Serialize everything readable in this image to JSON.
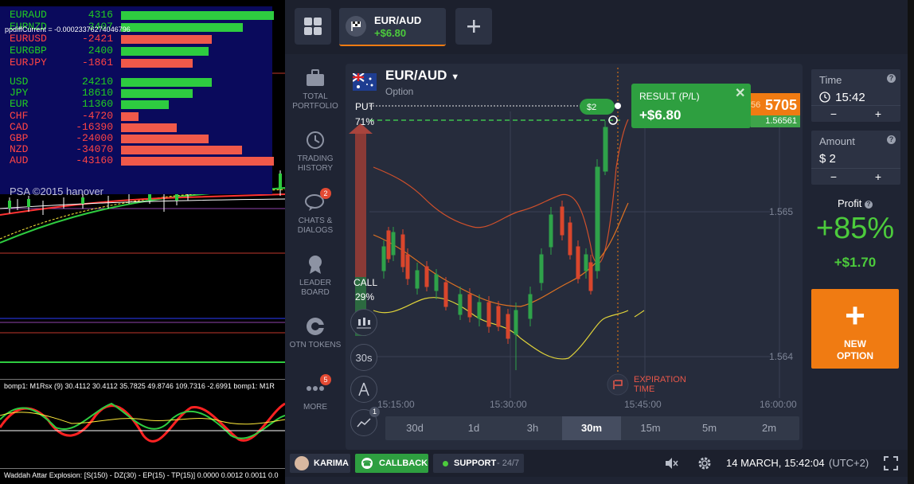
{
  "mt4": {
    "debug_text": "ppdiffCurrent = -0.00023376274046796",
    "pairs": [
      {
        "name": "EURAUD",
        "value": "4316",
        "color": "#22cc22"
      },
      {
        "name": "EURNZD",
        "value": "3407",
        "color": "#22cc22"
      },
      {
        "name": "EURUSD",
        "value": "-2421",
        "color": "#ff4444"
      },
      {
        "name": "EURGBP",
        "value": "2400",
        "color": "#22cc22"
      },
      {
        "name": "EURJPY",
        "value": "-1861",
        "color": "#ff4444"
      }
    ],
    "currencies": [
      {
        "name": "USD",
        "value": "24210",
        "color": "#22cc22"
      },
      {
        "name": "JPY",
        "value": "18610",
        "color": "#22cc22"
      },
      {
        "name": "EUR",
        "value": "11360",
        "color": "#22cc22"
      },
      {
        "name": "CHF",
        "value": "-4720",
        "color": "#ff4444"
      },
      {
        "name": "CAD",
        "value": "-16390",
        "color": "#ff4444"
      },
      {
        "name": "GBP",
        "value": "-24000",
        "color": "#ff4444"
      },
      {
        "name": "NZD",
        "value": "-34070",
        "color": "#ff4444"
      },
      {
        "name": "AUD",
        "value": "-43160",
        "color": "#ff4444"
      }
    ],
    "watermark": "PSA ©2015 hanover",
    "indicator1_label": "bomp1: M1Rsx (9) 30.4112 30.4112 35.7825 49.8746 109.7316 -2.6991 bomp1: M1R",
    "indicator2_label": "Waddah Attar Explosion: [S(150) - DZ(30) - EP(15) - TP(15)] 0.0000 0.0012 0.0011 0.0"
  },
  "topbar": {
    "asset_name": "EUR/AUD",
    "asset_profit": "+$6.80"
  },
  "sidebar": {
    "items": [
      {
        "label": "TOTAL PORTFOLIO",
        "icon": "briefcase-icon"
      },
      {
        "label": "TRADING HISTORY",
        "icon": "history-icon"
      },
      {
        "label": "CHATS & DIALOGS",
        "icon": "chat-icon",
        "badge": "2"
      },
      {
        "label": "LEADER BOARD",
        "icon": "medal-icon"
      },
      {
        "label": "OTN TOKENS",
        "icon": "token-icon"
      },
      {
        "label": "MORE",
        "icon": "more-icon",
        "badge": "5"
      }
    ]
  },
  "chart": {
    "pair": "EUR/AUD",
    "subtitle": "Option",
    "put_label": "PUT",
    "put_pct": "71%",
    "call_label": "CALL",
    "call_pct": "29%",
    "tool_30s": "30s",
    "tool_badge": "1",
    "price_levels": [
      "1.565",
      "1.564"
    ],
    "time_labels": [
      "15:15:00",
      "15:30:00",
      "15:45:00",
      "16:00:00"
    ],
    "result_title": "RESULT (P/L)",
    "result_value": "+$6.80",
    "trade_amount": "$2",
    "price_prefix": "56",
    "price_main": "5705",
    "price_sub": "1.56561",
    "expiration_label_1": "EXPIRATION",
    "expiration_label_2": "TIME",
    "timeframes": [
      "30d",
      "1d",
      "3h",
      "30m",
      "15m",
      "5m",
      "2m"
    ],
    "active_timeframe": "30m"
  },
  "rpanel": {
    "time_label": "Time",
    "time_value": "15:42",
    "amount_label": "Amount",
    "amount_value": "$ 2",
    "minus": "−",
    "plus": "+",
    "help": "?",
    "profit_label": "Profit",
    "profit_pct": "+85%",
    "profit_amt": "+$1.70",
    "new_option_plus": "+",
    "new_option_1": "NEW",
    "new_option_2": "OPTION"
  },
  "bottombar": {
    "user": "KARIMA",
    "callback": "CALLBACK",
    "support": "SUPPORT",
    "support_hours": "- 24/7",
    "datetime": "14 MARCH, 15:42:04",
    "timezone": "(UTC+2)"
  },
  "colors": {
    "accent_orange": "#f07b12",
    "profit_green": "#4ccb3c",
    "app_bg": "#1f2433"
  }
}
